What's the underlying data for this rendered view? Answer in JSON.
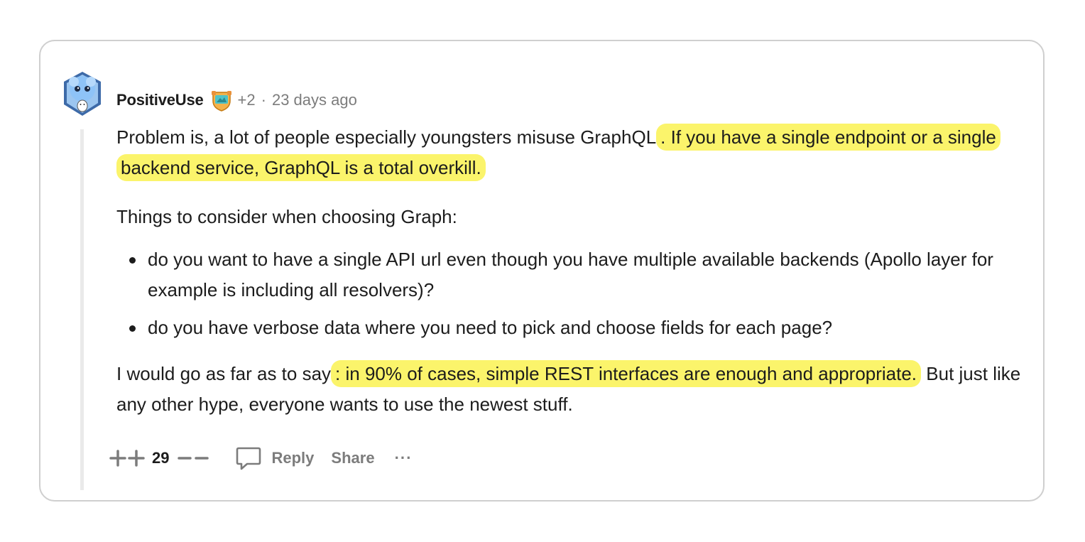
{
  "comment": {
    "username": "PositiveUse",
    "flair_icon": "award-badge-icon",
    "plus_count": "+2",
    "separator": "·",
    "timestamp": "23 days ago",
    "paragraph1_a": "Problem is, a lot of people especially youngsters misuse GraphQL",
    "paragraph1_b": ". If you have a single endpoint or a single backend service, GraphQL is a total overkill.",
    "paragraph2": "Things to consider when choosing Graph:",
    "bullets": [
      "do you want to have a single API url even though you have multiple available backends (Apollo layer for example is including all resolvers)?",
      "do you have verbose data where you need to pick and choose fields for each page?"
    ],
    "paragraph3_a": "I would go as far as to say",
    "paragraph3_b": ": in 90% of cases, simple REST interfaces are enough and appropriate.",
    "paragraph3_c": " But just like any other hype, everyone wants to use the newest stuff."
  },
  "actions": {
    "score": "29",
    "reply_label": "Reply",
    "share_label": "Share",
    "more_label": "···"
  },
  "colors": {
    "highlight": "#fbf46b",
    "muted_text": "#7c7c7c",
    "body_text": "#1c1c1c",
    "card_border": "#cfcfcf"
  }
}
